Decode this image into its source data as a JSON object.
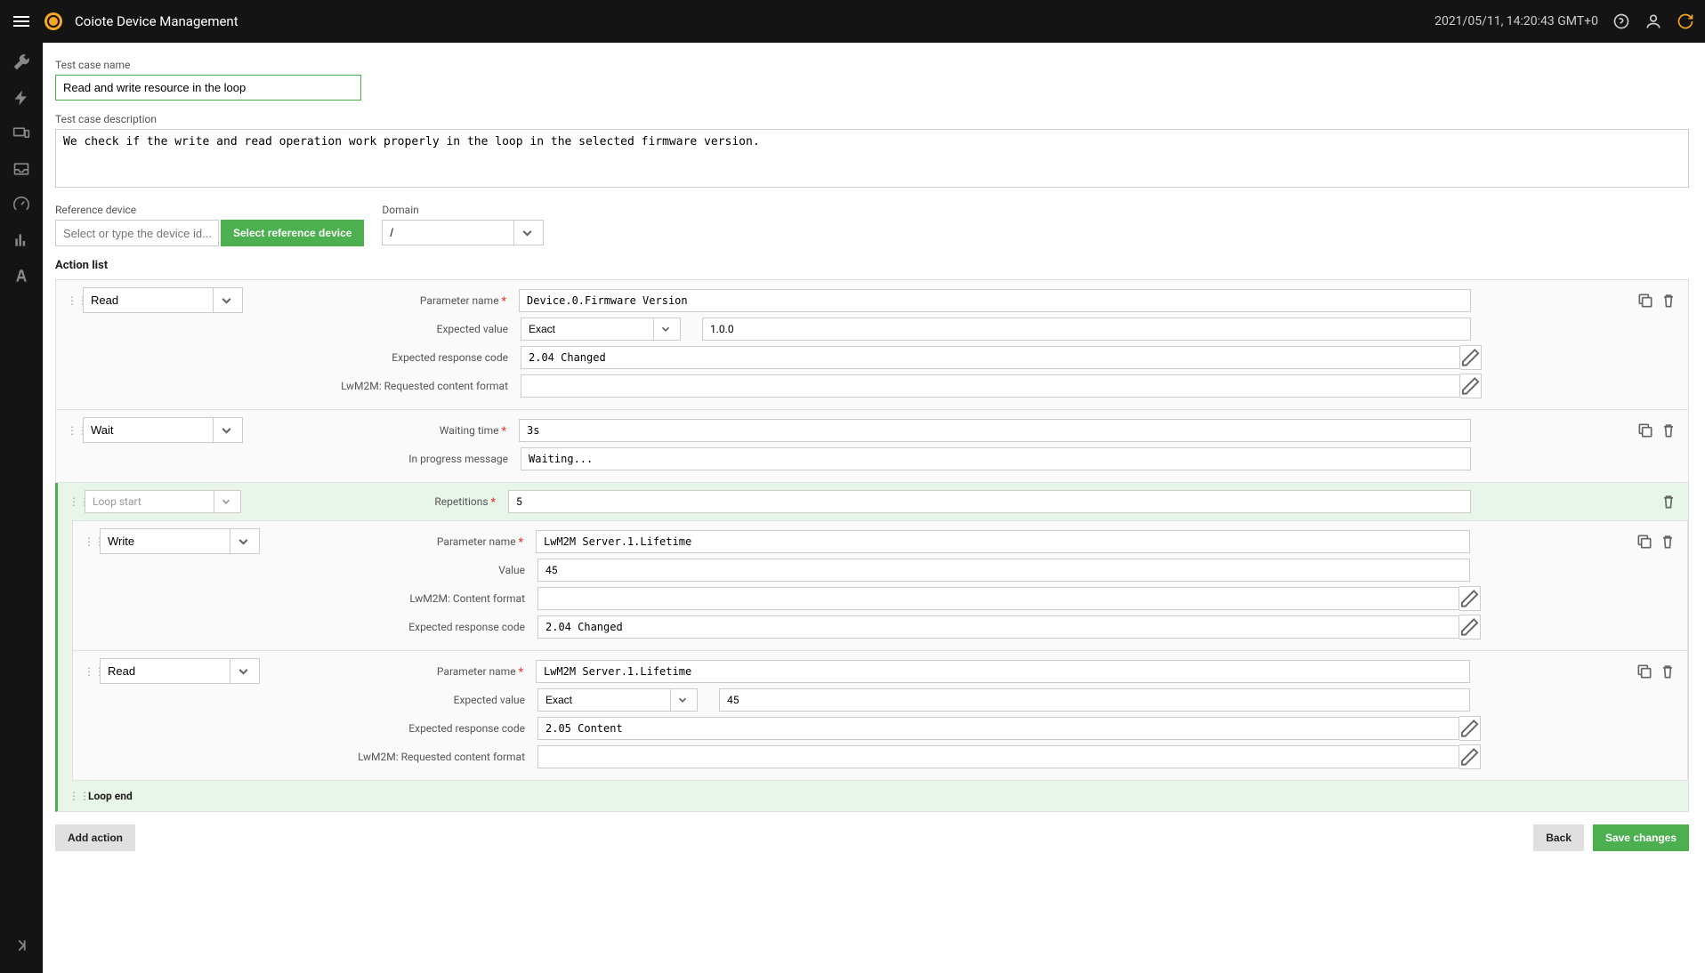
{
  "header": {
    "app_title": "Coiote Device Management",
    "timestamp": "2021/05/11, 14:20:43 GMT+0"
  },
  "form": {
    "name_label": "Test case name",
    "name_value": "Read and write resource in the loop",
    "desc_label": "Test case description",
    "desc_value": "We check if the write and read operation work properly in the loop in the selected firmware version.",
    "ref_device_label": "Reference device",
    "ref_device_placeholder": "Select or type the device id...",
    "select_ref_btn": "Select reference device",
    "domain_label": "Domain",
    "domain_value": "/"
  },
  "action_list_title": "Action list",
  "actions": {
    "read1": {
      "type": "Read",
      "param_name_label": "Parameter name",
      "param_name": "Device.0.Firmware Version",
      "expected_value_label": "Expected value",
      "expected_match": "Exact",
      "expected_value": "1.0.0",
      "response_code_label": "Expected response code",
      "response_code": "2.04 Changed",
      "content_format_label": "LwM2M: Requested content format",
      "content_format": ""
    },
    "wait": {
      "type": "Wait",
      "waiting_time_label": "Waiting time",
      "waiting_time": "3s",
      "progress_label": "In progress message",
      "progress_msg": "Waiting..."
    },
    "loop_start": {
      "type": "Loop start",
      "repetitions_label": "Repetitions",
      "repetitions": "5"
    },
    "write": {
      "type": "Write",
      "param_name_label": "Parameter name",
      "param_name": "LwM2M Server.1.Lifetime",
      "value_label": "Value",
      "value": "45",
      "content_format_label": "LwM2M: Content format",
      "content_format": "",
      "response_code_label": "Expected response code",
      "response_code": "2.04 Changed"
    },
    "read2": {
      "type": "Read",
      "param_name_label": "Parameter name",
      "param_name": "LwM2M Server.1.Lifetime",
      "expected_value_label": "Expected value",
      "expected_match": "Exact",
      "expected_value": "45",
      "response_code_label": "Expected response code",
      "response_code": "2.05 Content",
      "content_format_label": "LwM2M: Requested content format",
      "content_format": ""
    },
    "loop_end": "Loop end"
  },
  "footer": {
    "add_action": "Add action",
    "back": "Back",
    "save": "Save changes"
  }
}
